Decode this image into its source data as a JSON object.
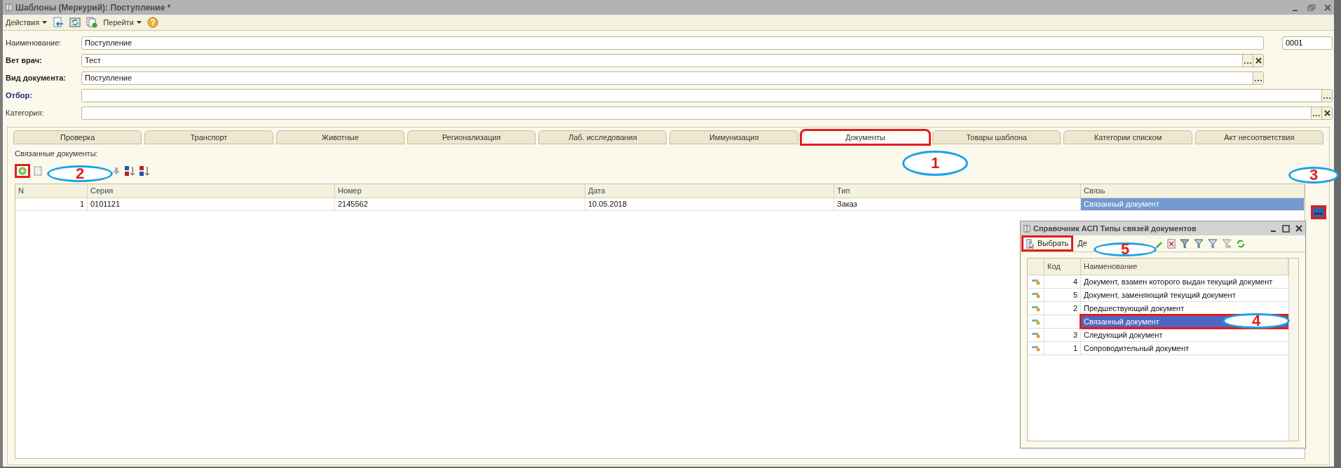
{
  "window": {
    "title": "Шаблоны (Меркурий): Поступление *"
  },
  "toolbar": {
    "actions_menu": "Действия",
    "goto_menu": "Перейти"
  },
  "fields": [
    {
      "label": "Наименование:",
      "kind": "plain",
      "value": "Поступление",
      "code": "0001",
      "select_button": false,
      "clear_button": false
    },
    {
      "label": "Вет врач:",
      "kind": "bold",
      "value": "Тест",
      "select_button": true,
      "clear_button": true
    },
    {
      "label": "Вид документа:",
      "kind": "bold",
      "value": "Поступление",
      "select_button": true,
      "clear_button": false
    },
    {
      "label": "Отбор:",
      "kind": "link",
      "select_button": true,
      "clear_button": false
    },
    {
      "label": "Категория:",
      "kind": "plain",
      "select_button": true,
      "clear_button": true
    }
  ],
  "tabs": [
    {
      "label": "Проверка",
      "selected": false
    },
    {
      "label": "Транспорт",
      "selected": false
    },
    {
      "label": "Животные",
      "selected": false
    },
    {
      "label": "Регионализация",
      "selected": false
    },
    {
      "label": "Лаб. исследования",
      "selected": false
    },
    {
      "label": "Иммунизация",
      "selected": false
    },
    {
      "label": "Документы",
      "selected": true
    },
    {
      "label": "Товары шаблона",
      "selected": false
    },
    {
      "label": "Категории списком",
      "selected": false
    },
    {
      "label": "Акт несоответствия",
      "selected": false
    }
  ],
  "linked_docs": {
    "title": "Связанные документы:",
    "columns": [
      "N",
      "Серия",
      "Номер",
      "Дата",
      "Тип",
      "Связь"
    ],
    "rows": [
      {
        "cells": [
          {
            "text": "1",
            "selected": false
          },
          {
            "text": "0101121",
            "selected": false
          },
          {
            "text": "2145562",
            "selected": false
          },
          {
            "text": "10.05.2018",
            "selected": false
          },
          {
            "text": "Заказ",
            "selected": false
          },
          {
            "text": "Связанный документ",
            "selected": true
          }
        ]
      }
    ]
  },
  "dialog": {
    "title": "Справочник АСП Типы связей документов",
    "select_button": "Выбрать",
    "actions_menu": "Де",
    "columns": [
      "Код",
      "Наименование"
    ],
    "rows": [
      {
        "code": "4",
        "name": "Документ, взамен которого выдан текущий документ",
        "selected": false
      },
      {
        "code": "5",
        "name": "Документ, заменяющий текущий документ",
        "selected": false
      },
      {
        "code": "2",
        "name": "Предшествующий документ",
        "selected": false
      },
      {
        "name": "Связанный документ",
        "selected": true
      },
      {
        "code": "3",
        "name": "Следующий документ",
        "selected": false
      },
      {
        "code": "1",
        "name": "Сопроводительный документ",
        "selected": false
      }
    ]
  },
  "callouts": [
    "1",
    "2",
    "3",
    "4",
    "5"
  ]
}
